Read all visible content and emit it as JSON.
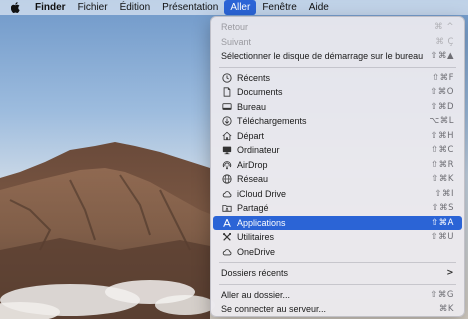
{
  "menubar": {
    "apple_icon": "apple-logo-icon",
    "items": [
      {
        "label": "Finder"
      },
      {
        "label": "Fichier"
      },
      {
        "label": "Édition"
      },
      {
        "label": "Présentation"
      },
      {
        "label": "Aller"
      },
      {
        "label": "Fenêtre"
      },
      {
        "label": "Aide"
      }
    ]
  },
  "menu": {
    "history": [
      {
        "label": "Retour",
        "shortcut": "⌘ ^",
        "disabled": true
      },
      {
        "label": "Suivant",
        "shortcut": "⌘ Ç",
        "disabled": true
      },
      {
        "label": "Sélectionner le disque de démarrage sur le bureau",
        "shortcut": "⇧⌘▲",
        "disabled": false
      }
    ],
    "places": [
      {
        "label": "Récents",
        "shortcut": "⇧⌘F",
        "icon": "clock-icon"
      },
      {
        "label": "Documents",
        "shortcut": "⇧⌘O",
        "icon": "document-icon"
      },
      {
        "label": "Bureau",
        "shortcut": "⇧⌘D",
        "icon": "desktop-icon"
      },
      {
        "label": "Téléchargements",
        "shortcut": "⌥⌘L",
        "icon": "download-icon"
      },
      {
        "label": "Départ",
        "shortcut": "⇧⌘H",
        "icon": "home-icon"
      },
      {
        "label": "Ordinateur",
        "shortcut": "⇧⌘C",
        "icon": "computer-icon"
      },
      {
        "label": "AirDrop",
        "shortcut": "⇧⌘R",
        "icon": "airdrop-icon"
      },
      {
        "label": "Réseau",
        "shortcut": "⇧⌘K",
        "icon": "network-icon"
      },
      {
        "label": "iCloud Drive",
        "shortcut": "⇧⌘I",
        "icon": "cloud-icon"
      },
      {
        "label": "Partagé",
        "shortcut": "⇧⌘S",
        "icon": "shared-folder-icon"
      },
      {
        "label": "Applications",
        "shortcut": "⇧⌘A",
        "icon": "applications-icon",
        "selected": true
      },
      {
        "label": "Utilitaires",
        "shortcut": "⇧⌘U",
        "icon": "utilities-icon"
      },
      {
        "label": "OneDrive",
        "shortcut": "",
        "icon": "cloud-icon"
      }
    ],
    "recent_folders": {
      "label": "Dossiers récents",
      "shortcut": ">"
    },
    "goto": [
      {
        "label": "Aller au dossier...",
        "shortcut": "⇧⌘G"
      },
      {
        "label": "Se connecter au serveur...",
        "shortcut": "⌘K"
      }
    ]
  },
  "colors": {
    "accent": "#2b64d6",
    "menubar_bg": "#d6e2f0",
    "menu_bg": "#ece9ee",
    "disabled_text": "#9a9aa0"
  }
}
